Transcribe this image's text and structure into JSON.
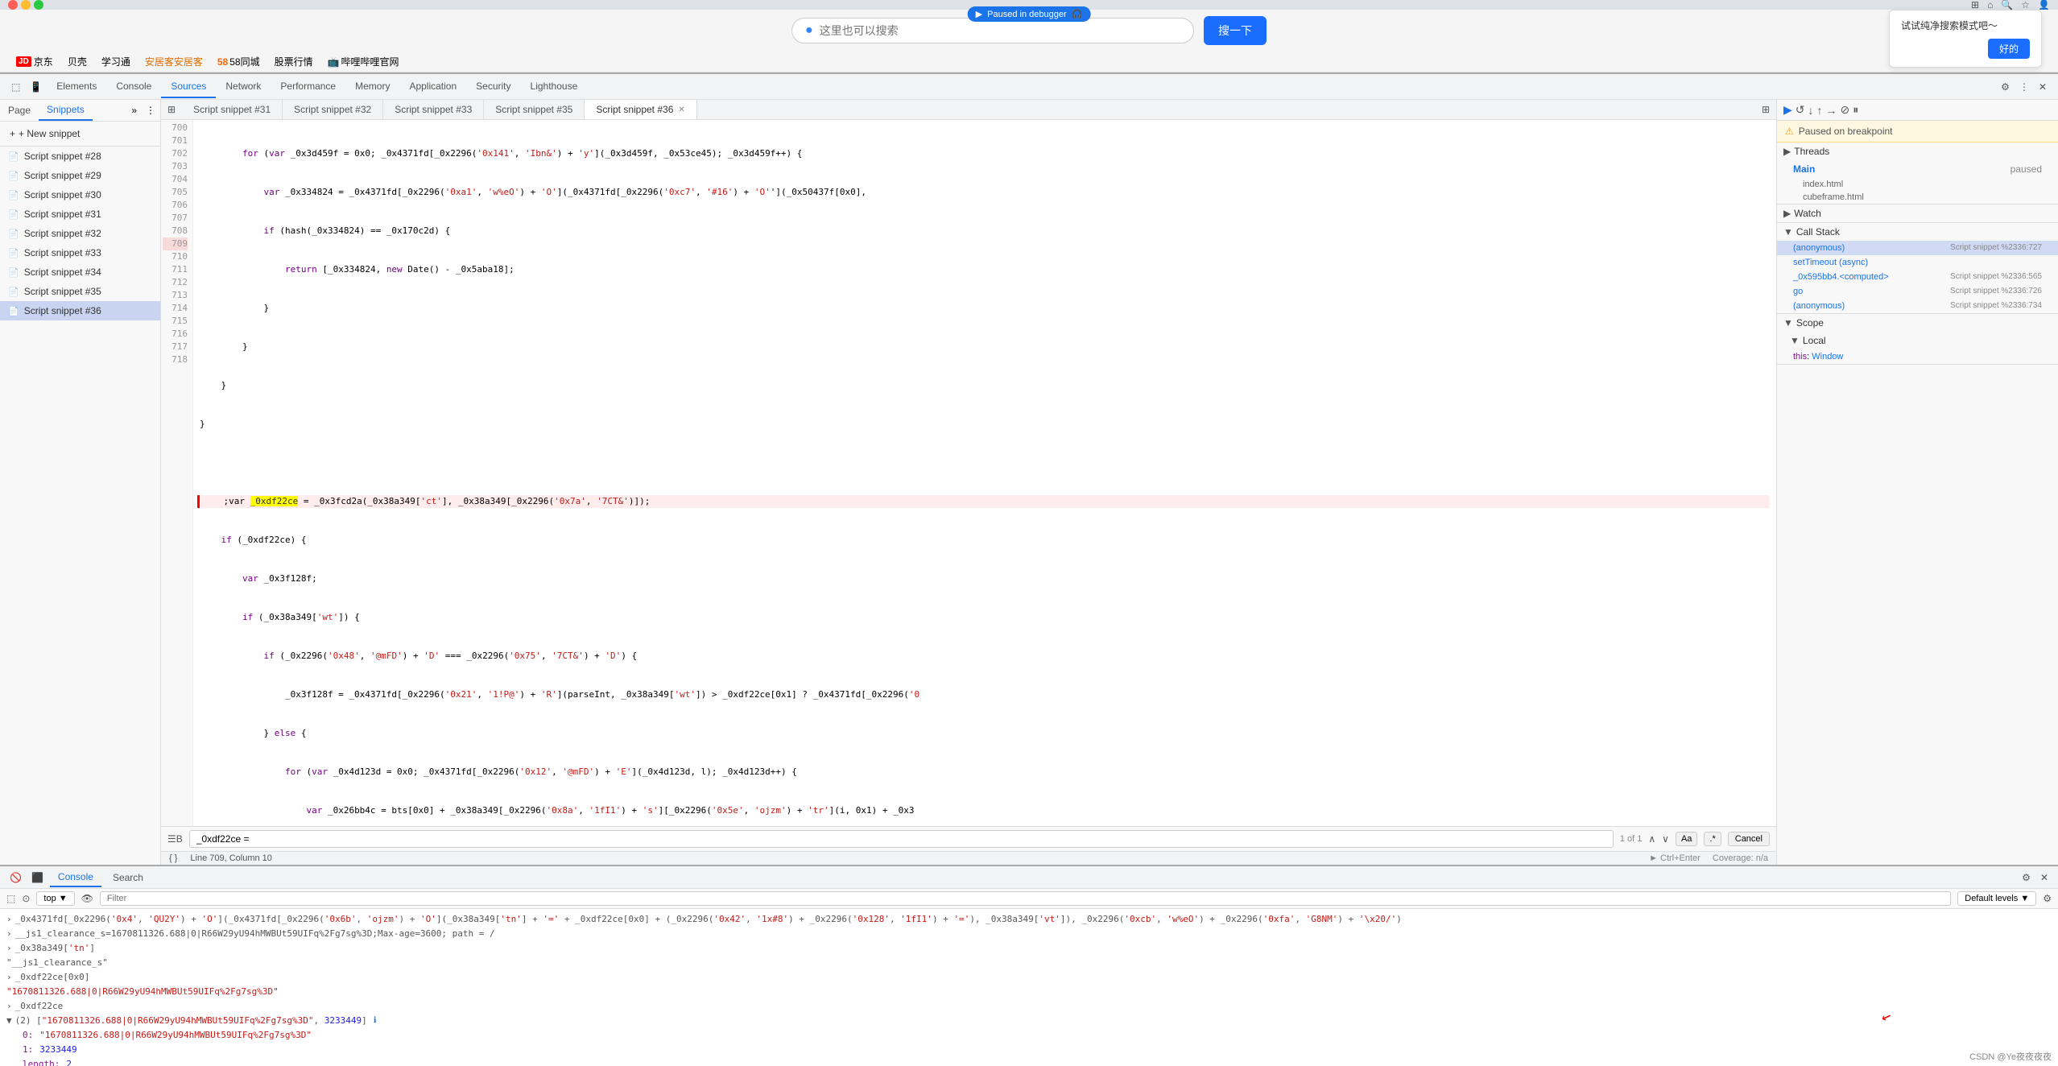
{
  "browser": {
    "paused_label": "Paused in debugger",
    "search_placeholder": "这里也可以搜索",
    "search_button": "搜一下",
    "bookmarks": [
      {
        "label": "京东",
        "prefix": "JD",
        "color": "red"
      },
      {
        "label": "贝壳"
      },
      {
        "label": "学习通"
      },
      {
        "label": "安居客安居客",
        "highlight": true
      },
      {
        "label": "58同城",
        "prefix": "58",
        "highlight_num": true
      },
      {
        "label": "股票行情"
      },
      {
        "label": "哔哩哔哩官网"
      }
    ],
    "promo": {
      "title": "试试纯净搜索模式吧～",
      "ok_button": "好的"
    }
  },
  "devtools": {
    "tabs": [
      {
        "label": "Elements",
        "active": false
      },
      {
        "label": "Console",
        "active": false
      },
      {
        "label": "Sources",
        "active": true
      },
      {
        "label": "Network",
        "active": false
      },
      {
        "label": "Performance",
        "active": false
      },
      {
        "label": "Memory",
        "active": false
      },
      {
        "label": "Application",
        "active": false
      },
      {
        "label": "Security",
        "active": false
      },
      {
        "label": "Lighthouse",
        "active": false
      }
    ]
  },
  "sources": {
    "sidebar": {
      "tabs": [
        {
          "label": "Page",
          "active": false
        },
        {
          "label": "Snippets",
          "active": true
        }
      ],
      "new_snippet_label": "+ New snippet",
      "snippets": [
        {
          "label": "Script snippet #28"
        },
        {
          "label": "Script snippet #29"
        },
        {
          "label": "Script snippet #30"
        },
        {
          "label": "Script snippet #31"
        },
        {
          "label": "Script snippet #32"
        },
        {
          "label": "Script snippet #33"
        },
        {
          "label": "Script snippet #34"
        },
        {
          "label": "Script snippet #35"
        },
        {
          "label": "Script snippet #36",
          "active": true
        }
      ]
    },
    "code_tabs": [
      {
        "label": "Script snippet #31"
      },
      {
        "label": "Script snippet #32"
      },
      {
        "label": "Script snippet #33"
      },
      {
        "label": "Script snippet #35"
      },
      {
        "label": "Script snippet #36",
        "active": true,
        "closeable": true
      }
    ],
    "code_lines": [
      {
        "num": 700,
        "text": "        for (var _0x3d459f = 0x0; _0x4371fd[_0x2296('0x141', 'Ibn&') + 'y'](_0x3d459f, _0x53ce45); _0x3d459f++) {"
      },
      {
        "num": 701,
        "text": "            var _0x334824 = _0x4371fd[_0x2296('0xa1', 'w%eO') + 'O'](_0x4371fd[_0x2296('0xc7', '#16')] + 'O'](_0x50437f[0x0],"
      },
      {
        "num": 702,
        "text": "            if (hash(_0x334824) == _0x170c2d) {"
      },
      {
        "num": 703,
        "text": "                return [_0x334824, new Date() - _0x5aba18];"
      },
      {
        "num": 704,
        "text": "            }"
      },
      {
        "num": 705,
        "text": "        }"
      },
      {
        "num": 706,
        "text": "    }"
      },
      {
        "num": 707,
        "text": "}"
      },
      {
        "num": 708,
        "text": ""
      },
      {
        "num": 709,
        "text": "    ;var _0xdf22ce = _0x3fcd2a(_0x38a349['ct'], _0x38a349[_0x2296('0x7a', '7CT&')]);",
        "breakpoint": true
      },
      {
        "num": 710,
        "text": "    if (_0xdf22ce) {"
      },
      {
        "num": 711,
        "text": "        var _0x3f128f;"
      },
      {
        "num": 712,
        "text": "        if (_0x38a349['wt']) {"
      },
      {
        "num": 713,
        "text": "            if (_0x2296('0x48', '@mFD') + 'D' === _0x2296('0x75', '7CT&') + 'D') {"
      },
      {
        "num": 714,
        "text": "                _0x3f128f = _0x4371fd[_0x2296('0x21', '1!P@') + 'R'](parseInt, _0x38a349['wt']) > _0xdf22ce[0x1] ? _0x4371fd[_0x2296('0"
      },
      {
        "num": 715,
        "text": "            } else {"
      },
      {
        "num": 716,
        "text": "                for (var _0x4d123d = 0x0; _0x4371fd[_0x2296('0x12', '@mFD') + 'E'](_0x4d123d, l); _0x4d123d++) {"
      },
      {
        "num": 717,
        "text": "                    var _0x26bb4c = bts[0x0] + _0x38a349[_0x2296('0x8a', '1fI1') + 's'][_0x2296('0x5e', 'ojzm') + 'tr'](i, 0x1) + _0x3"
      },
      {
        "num": 718,
        "text": ""
      }
    ],
    "search_value": "_0xdf22ce =",
    "search_match_info": "1 of 1",
    "status_line": "Line 709, Column 10",
    "status_coverage": "Coverage: n/a",
    "ctrl_enter": "Ctrl+Enter"
  },
  "right_panel": {
    "breakpoint_notice": "Paused on breakpoint",
    "threads": {
      "header": "Threads",
      "items": [
        {
          "name": "Main",
          "status": "paused"
        },
        {
          "file": "index.html"
        },
        {
          "file": "cubeframe.html"
        }
      ]
    },
    "watch_header": "Watch",
    "call_stack": {
      "header": "Call Stack",
      "items": [
        {
          "name": "(anonymous)",
          "location": "Script snippet %2336:727",
          "selected": true
        },
        {
          "name": "setTimeout (async)"
        },
        {
          "name": "_0x595bb4.<computed>",
          "location": "Script snippet %2336:565"
        },
        {
          "name": "go",
          "location": "Script snippet %2336:726"
        },
        {
          "name": "(anonymous)",
          "location": "Script snippet %2336:734"
        }
      ]
    },
    "scope": {
      "header": "Scope",
      "local_header": "Local",
      "items": [
        {
          "key": "this",
          "value": "Window"
        }
      ]
    }
  },
  "console": {
    "tabs": [
      {
        "label": "Console",
        "active": true
      },
      {
        "label": "Search"
      }
    ],
    "toolbar": {
      "context": "top",
      "filter_placeholder": "Filter",
      "levels": "Default levels ▼"
    },
    "lines": [
      {
        "type": "code",
        "arrow": "›",
        "text": "_0x4371fd[_0x2296('0x4', 'QU2Y') + 'O'](_0x4371fd[_0x2296('0x6b', 'ojzm') + 'O'](_0x38a349['tn'] + '=' + _0xdf22ce[0x0] + (_0x2296('0x42', '1x#8') + _0x2296('0x128', '1fI1') + '='), _0x38a349['vt']), _0x2296('0xcb', 'w%eO') + _0x2296('0xfa', 'G8NM') + '\\x20/')"
      },
      {
        "type": "code",
        "arrow": "›",
        "text": "__js1_clearance_s=1670811326.688|0|R66W29yU94hMWBUt59UIFq%2Fg7sg%3D;Max-age=3600; path = /"
      },
      {
        "type": "arrow",
        "arrow": "›",
        "text": "_0x38a349['tn']"
      },
      {
        "type": "string",
        "arrow": "",
        "text": "\"__js1_clearance_s\""
      },
      {
        "type": "arrow",
        "arrow": "›",
        "text": "_0xdf22ce[0x0]"
      },
      {
        "type": "string",
        "arrow": "",
        "text": "\"1670811326.688|0|R66W29yU94hMWBUt59UIFq%2Fg7sg%3D\""
      },
      {
        "type": "arrow",
        "arrow": "›",
        "text": "_0xdf22ce"
      },
      {
        "type": "array_collapsed",
        "text": "▼ (2) [\"1670811326.688|0|R66W29yU94hMWBUt59UIFq%2Fg7sg%3D\", 3233449]"
      },
      {
        "type": "array_item",
        "index": "0:",
        "value": "\"1670811326.688|0|R66W29yU94hMWBUt59UIFq%2Fg7sg%3D\""
      },
      {
        "type": "array_item",
        "index": "1:",
        "value": "3233449"
      },
      {
        "type": "array_item",
        "index": "length:",
        "value": "2"
      }
    ]
  },
  "watermark": "CSDN @Ye夜夜夜夜"
}
